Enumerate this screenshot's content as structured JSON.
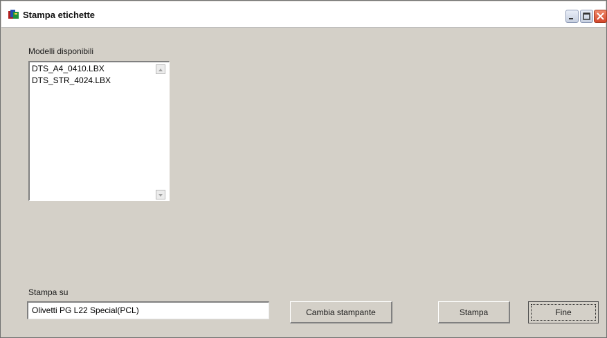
{
  "window": {
    "title": "Stampa etichette",
    "controls": {
      "minimize_icon": "minimize-icon",
      "maximize_icon": "maximize-icon",
      "close_icon": "close-icon"
    }
  },
  "models": {
    "label": "Modelli disponibili",
    "items": [
      "DTS_A4_0410.LBX",
      "DTS_STR_4024.LBX"
    ]
  },
  "printer": {
    "label": "Stampa su",
    "value": "Olivetti PG L22 Special(PCL)"
  },
  "buttons": {
    "change_printer": "Cambia stampante",
    "print": "Stampa",
    "end": "Fine"
  }
}
